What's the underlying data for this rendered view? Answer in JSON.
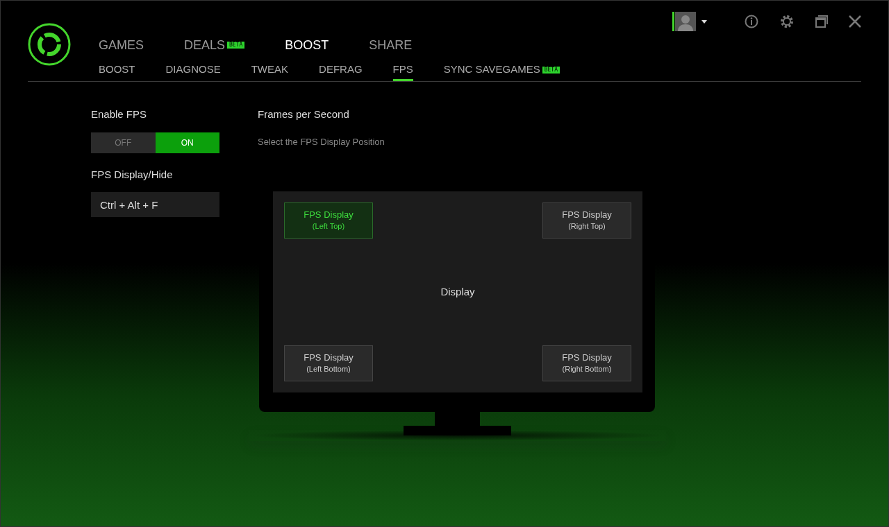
{
  "user": {
    "online": true
  },
  "main_tabs": [
    {
      "label": "GAMES",
      "selected": false
    },
    {
      "label": "DEALS",
      "selected": false,
      "badge": "BETA"
    },
    {
      "label": "BOOST",
      "selected": true
    },
    {
      "label": "SHARE",
      "selected": false
    }
  ],
  "sub_tabs": [
    {
      "label": "BOOST",
      "selected": false
    },
    {
      "label": "DIAGNOSE",
      "selected": false
    },
    {
      "label": "TWEAK",
      "selected": false
    },
    {
      "label": "DEFRAG",
      "selected": false
    },
    {
      "label": "FPS",
      "selected": true
    },
    {
      "label": "SYNC SAVEGAMES",
      "selected": false,
      "badge": "BETA"
    }
  ],
  "enable_fps": {
    "label": "Enable FPS",
    "options": [
      {
        "label": "OFF",
        "selected": false
      },
      {
        "label": "ON",
        "selected": true
      }
    ]
  },
  "hotkey": {
    "label": "FPS Display/Hide",
    "value": "Ctrl + Alt + F"
  },
  "fps": {
    "title": "Frames per Second",
    "subtitle": "Select the FPS Display Position",
    "display_label": "Display",
    "positions": [
      {
        "label": "FPS Display",
        "detail": "(Left Top)",
        "selected": true
      },
      {
        "label": "FPS Display",
        "detail": "(Right Top)",
        "selected": false
      },
      {
        "label": "FPS Display",
        "detail": "(Left Bottom)",
        "selected": false
      },
      {
        "label": "FPS Display",
        "detail": "(Right Bottom)",
        "selected": false
      }
    ]
  }
}
